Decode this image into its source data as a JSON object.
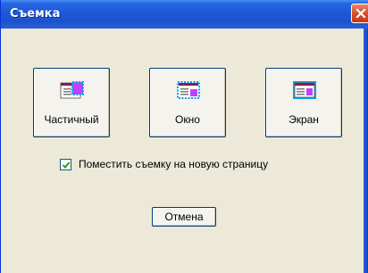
{
  "window": {
    "title": "Съемка",
    "title_color": "#ffffff",
    "titlebar_color": "#1d58d8",
    "face_color": "#ece9d8",
    "close_icon": "close-icon"
  },
  "capture_buttons": [
    {
      "label": "Частичный",
      "icon": "partial-capture-icon"
    },
    {
      "label": "Окно",
      "icon": "window-capture-icon"
    },
    {
      "label": "Экран",
      "icon": "screen-capture-icon"
    }
  ],
  "options": {
    "new_page_label": "Поместить съемку на новую страницу",
    "new_page_checked": true
  },
  "cancel_label": "Отмена",
  "icon_colors": {
    "selection": "#00a2e8",
    "window_bar": "#8b1a4f",
    "highlight": "#c040ff"
  }
}
